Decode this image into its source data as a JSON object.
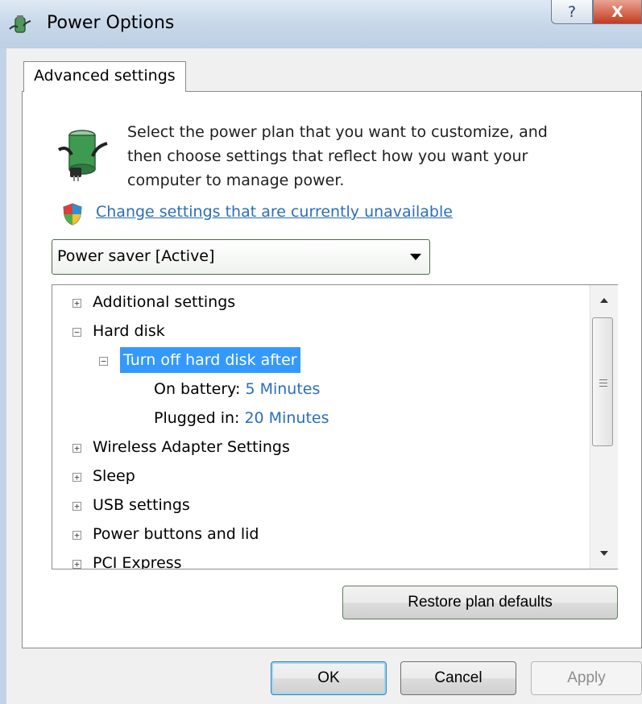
{
  "window": {
    "title": "Power Options",
    "help_label": "?",
    "close_label": "X"
  },
  "tab": {
    "label": "Advanced settings"
  },
  "intro": {
    "line1": "Select the power plan that you want to customize, and",
    "line2": "then choose settings that reflect how you want your",
    "line3": "computer to manage power."
  },
  "change_link": "Change settings that are currently unavailable",
  "plan_select": {
    "value": "Power saver [Active]"
  },
  "tree": {
    "items": [
      {
        "label": "Additional settings",
        "expander": "+"
      },
      {
        "label": "Hard disk",
        "expander": "−"
      },
      {
        "label": "Turn off hard disk after",
        "expander": "−"
      },
      {
        "label": "On battery:",
        "value": "5 Minutes"
      },
      {
        "label": "Plugged in:",
        "value": "20 Minutes"
      },
      {
        "label": "Wireless Adapter Settings",
        "expander": "+"
      },
      {
        "label": "Sleep",
        "expander": "+"
      },
      {
        "label": "USB settings",
        "expander": "+"
      },
      {
        "label": "Power buttons and lid",
        "expander": "+"
      },
      {
        "label": "PCI Express",
        "expander": "+"
      }
    ]
  },
  "buttons": {
    "restore": "Restore plan defaults",
    "ok": "OK",
    "cancel": "Cancel",
    "apply": "Apply"
  },
  "colors": {
    "link": "#2a6ebd",
    "selection": "#3399ff"
  }
}
